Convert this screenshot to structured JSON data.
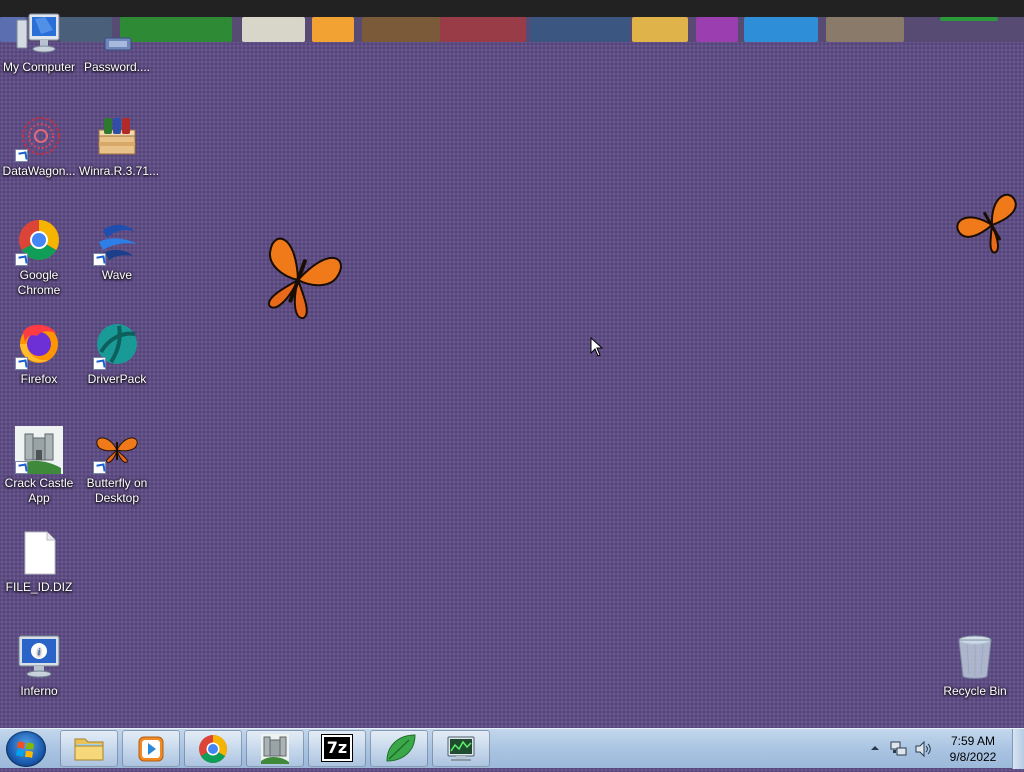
{
  "desktop": {
    "icons": [
      {
        "label": "My Computer",
        "icon": "computer-icon"
      },
      {
        "label": "Password....",
        "icon": "password-icon"
      },
      {
        "label": "DataWagon...",
        "icon": "datawagon-icon"
      },
      {
        "label": "Winra.R.3.71...",
        "icon": "winrar-icon"
      },
      {
        "label": "Google Chrome",
        "icon": "chrome-icon"
      },
      {
        "label": "Wave",
        "icon": "wave-icon"
      },
      {
        "label": "Firefox",
        "icon": "firefox-icon"
      },
      {
        "label": "DriverPack",
        "icon": "driverpack-icon"
      },
      {
        "label": "Crack Castle App",
        "icon": "castle-icon"
      },
      {
        "label": "Butterfly on Desktop",
        "icon": "butterfly-icon"
      },
      {
        "label": "FILE_ID.DIZ",
        "icon": "document-icon"
      },
      {
        "label": "Inferno",
        "icon": "info-monitor-icon"
      },
      {
        "label": "Recycle Bin",
        "icon": "recycle-bin-icon"
      }
    ]
  },
  "taskbar": {
    "pinned": [
      {
        "name": "Windows Explorer",
        "icon": "folder-icon"
      },
      {
        "name": "Media Player",
        "icon": "media-player-icon"
      },
      {
        "name": "Google Chrome",
        "icon": "chrome-icon"
      },
      {
        "name": "Crack Castle App",
        "icon": "castle-icon"
      },
      {
        "name": "7-Zip",
        "icon": "sevenzip-icon"
      },
      {
        "name": "Leaf App",
        "icon": "leaf-icon"
      },
      {
        "name": "Network App",
        "icon": "network-monitor-icon"
      }
    ],
    "sevenzip_text": "7z",
    "clock": {
      "time": "7:59 AM",
      "date": "9/8/2022"
    }
  },
  "colors": {
    "desktop": "#5e4c84",
    "taskbar": "#aac4e2",
    "butterfly": "#f07a1a"
  }
}
